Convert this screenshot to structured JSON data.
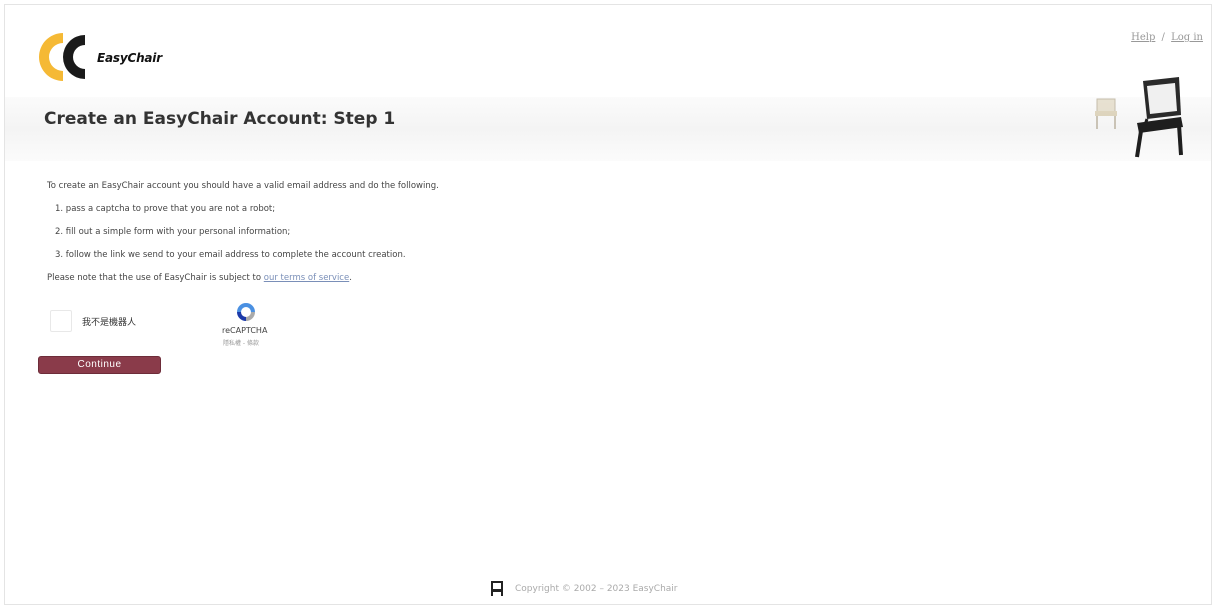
{
  "header": {
    "logo_text": "EasyChair",
    "help_link": "Help",
    "separator": "/",
    "login_link": "Log in"
  },
  "page": {
    "title": "Create an EasyChair Account: Step 1"
  },
  "content": {
    "intro": "To create an EasyChair account you should have a valid email address and do the following.",
    "steps": [
      "1. pass a captcha to prove that you are not a robot;",
      "2. fill out a simple form with your personal information;",
      "3. follow the link we send to your email address to complete the account creation."
    ],
    "note_prefix": "Please note that the use of EasyChair is subject to",
    "terms_link": "our terms of service",
    "note_suffix": "."
  },
  "recaptcha": {
    "label": "我不是機器人",
    "brand": "reCAPTCHA",
    "terms": "隱私權 - 條款"
  },
  "form": {
    "continue_label": "Continue"
  },
  "footer": {
    "copyright": "Copyright © 2002 – 2023 EasyChair"
  },
  "colors": {
    "button": "#8a3b4a",
    "link": "#7a8fb8",
    "logo_orange": "#f5a623"
  }
}
